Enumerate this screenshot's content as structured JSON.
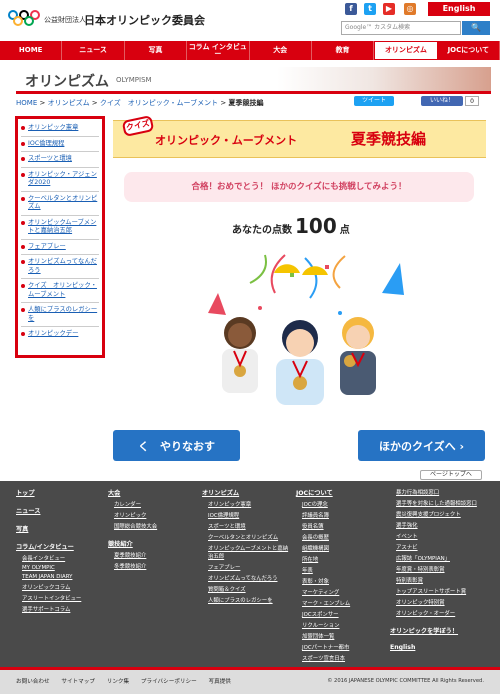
{
  "header": {
    "org_small": "公益財団法人",
    "org_name": "日本オリンピック委員会",
    "english": "English",
    "search_placeholder": "Google™ カスタム検索",
    "search_button": "🔍"
  },
  "nav": [
    "HOME",
    "ニュース",
    "写真",
    "コラム インタビュー",
    "大会",
    "教育",
    "オリンピズム",
    "JOCについて"
  ],
  "banner": {
    "title": "オリンピズム",
    "subtitle": "OLYMPISM"
  },
  "breadcrumb": {
    "home": "HOME",
    "olympism": "オリンピズム",
    "quiz": "クイズ　オリンピック・ムーブメント",
    "current": "夏季競技編"
  },
  "social": {
    "tweet": "ツイート",
    "like": "いいね！",
    "like_count": "0"
  },
  "sidebar": [
    "オリンピック憲章",
    "IOC倫理規程",
    "スポーツと環境",
    "オリンピック・アジェンダ2020",
    "クーベルタンとオリンピズム",
    "オリンピックムーブメントと嘉納治五郎",
    "フェアプレー",
    "オリンピズムってなんだろう",
    "クイズ　オリンピック・ムーブメント",
    "人類にプラスのレガシーを",
    "オリンピックデー"
  ],
  "quiz": {
    "badge": "クイズ",
    "title": "オリンピック・ムーブメント",
    "edition": "夏季競技編"
  },
  "result": "合格！おめでとう！ ほかのクイズにも挑戦してみよう！",
  "score": {
    "label": "あなたの点数",
    "value": "100",
    "unit": "点"
  },
  "buttons": {
    "retry": "く　やりなおす",
    "other": "ほかのクイズへ ›"
  },
  "pagetop": "ページトップへ",
  "footer": {
    "col1": [
      "トップ",
      "ニュース",
      "写真",
      "コラム/インタビュー",
      "会長インタビュー",
      "MY OLYMPIC",
      "TEAM JAPAN DIARY",
      "オリンピックコラム",
      "アスリートインタビュー",
      "選手サポートコラム"
    ],
    "col2": [
      "大会",
      "カレンダー",
      "オリンピック",
      "国際総合競技大会",
      "競技紹介",
      "夏季競技紹介",
      "冬季競技紹介"
    ],
    "col3": [
      "オリンピズム",
      "オリンピック憲章",
      "IOC倫理規程",
      "スポーツと環境",
      "クーベルタンとオリンピズム",
      "オリンピックムーブメントと嘉納治五郎",
      "フェアプレー",
      "オリンピズムってなんだろう",
      "質問箱＆クイズ",
      "人類にプラスのレガシーを"
    ],
    "col4": [
      "JOCについて",
      "JOCの理念",
      "評議員名簿",
      "役員名簿",
      "会長の概歴",
      "組織機構図",
      "所在地",
      "年表",
      "表彰・対象",
      "マーケティング",
      "マーク・エンブレム",
      "JOCスポンサー",
      "リクルーション",
      "加盟団体一覧",
      "JOCパートナー都市",
      "スポーツ宣言日本"
    ],
    "col5": [
      "暴力行為相談窓口",
      "選手等を対象にした通報相談窓口",
      "震災復興支援プロジェクト",
      "選手強化",
      "イベント",
      "アスナビ",
      "広報誌「OLYMPIAN」",
      "年度賞・特別表彰賞",
      "特別表彰賞",
      "トップアスリートサポート賞",
      "オリンピック特別賞",
      "オリンピック・オーダー"
    ],
    "learn": "オリンピックを学ぼう！",
    "english": "English"
  },
  "bottom": {
    "links": [
      "お問い合わせ",
      "サイトマップ",
      "リンク集",
      "プライバシーポリシー",
      "写真提供"
    ],
    "copyright": "© 2016 JAPANESE OLYMPIC COMMITTEE All Rights Reserved."
  },
  "colors": {
    "brand_red": "#d8000f",
    "link_blue": "#1a5fb4",
    "button_blue": "#2673c4",
    "quiz_yellow": "#fde9a1"
  }
}
